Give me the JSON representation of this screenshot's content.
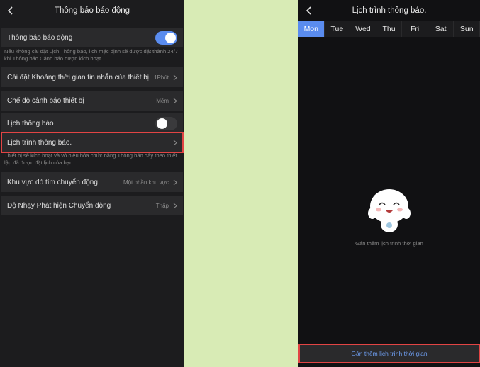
{
  "left": {
    "title": "Thông báo báo động",
    "alarm_toggle_label": "Thông báo báo động",
    "alarm_note": "Nếu không cài đặt Lịch Thông báo, lịch mặc định sẽ được đặt thành 24/7 khi Thông báo Cảnh báo được kích hoạt.",
    "interval_label": "Cài đặt Khoảng thời gian tin nhắn của thiết bị",
    "interval_value": "1Phút",
    "alert_mode_label": "Chế độ cảnh báo thiết bị",
    "alert_mode_value": "Mềm",
    "schedule_toggle_label": "Lịch thông báo",
    "schedule_label": "Lịch trình thông báo.",
    "schedule_note": "Thiết bị sẽ kích hoạt và vô hiệu hóa chức năng Thông báo đẩy theo thiết lập đã được đặt lịch của bạn.",
    "motion_zone_label": "Khu vực dò tìm chuyển động",
    "motion_zone_value": "Một phần khu vực",
    "sensitivity_label": "Độ Nhạy Phát hiện Chuyển động",
    "sensitivity_value": "Thấp",
    "alarm_enabled": true,
    "schedule_enabled": false
  },
  "right": {
    "title": "Lịch trình thông báo.",
    "days": [
      "Mon",
      "Tue",
      "Wed",
      "Thu",
      "Fri",
      "Sat",
      "Sun"
    ],
    "selected_day": "Mon",
    "empty_text": "Gán thêm lịch trình thời gian",
    "add_button": "Gán thêm lịch trình thời  gian"
  },
  "colors": {
    "accent": "#5a8cef",
    "highlight": "#e24444",
    "background": "#1c1c1e",
    "gap": "#d8ebb5"
  }
}
